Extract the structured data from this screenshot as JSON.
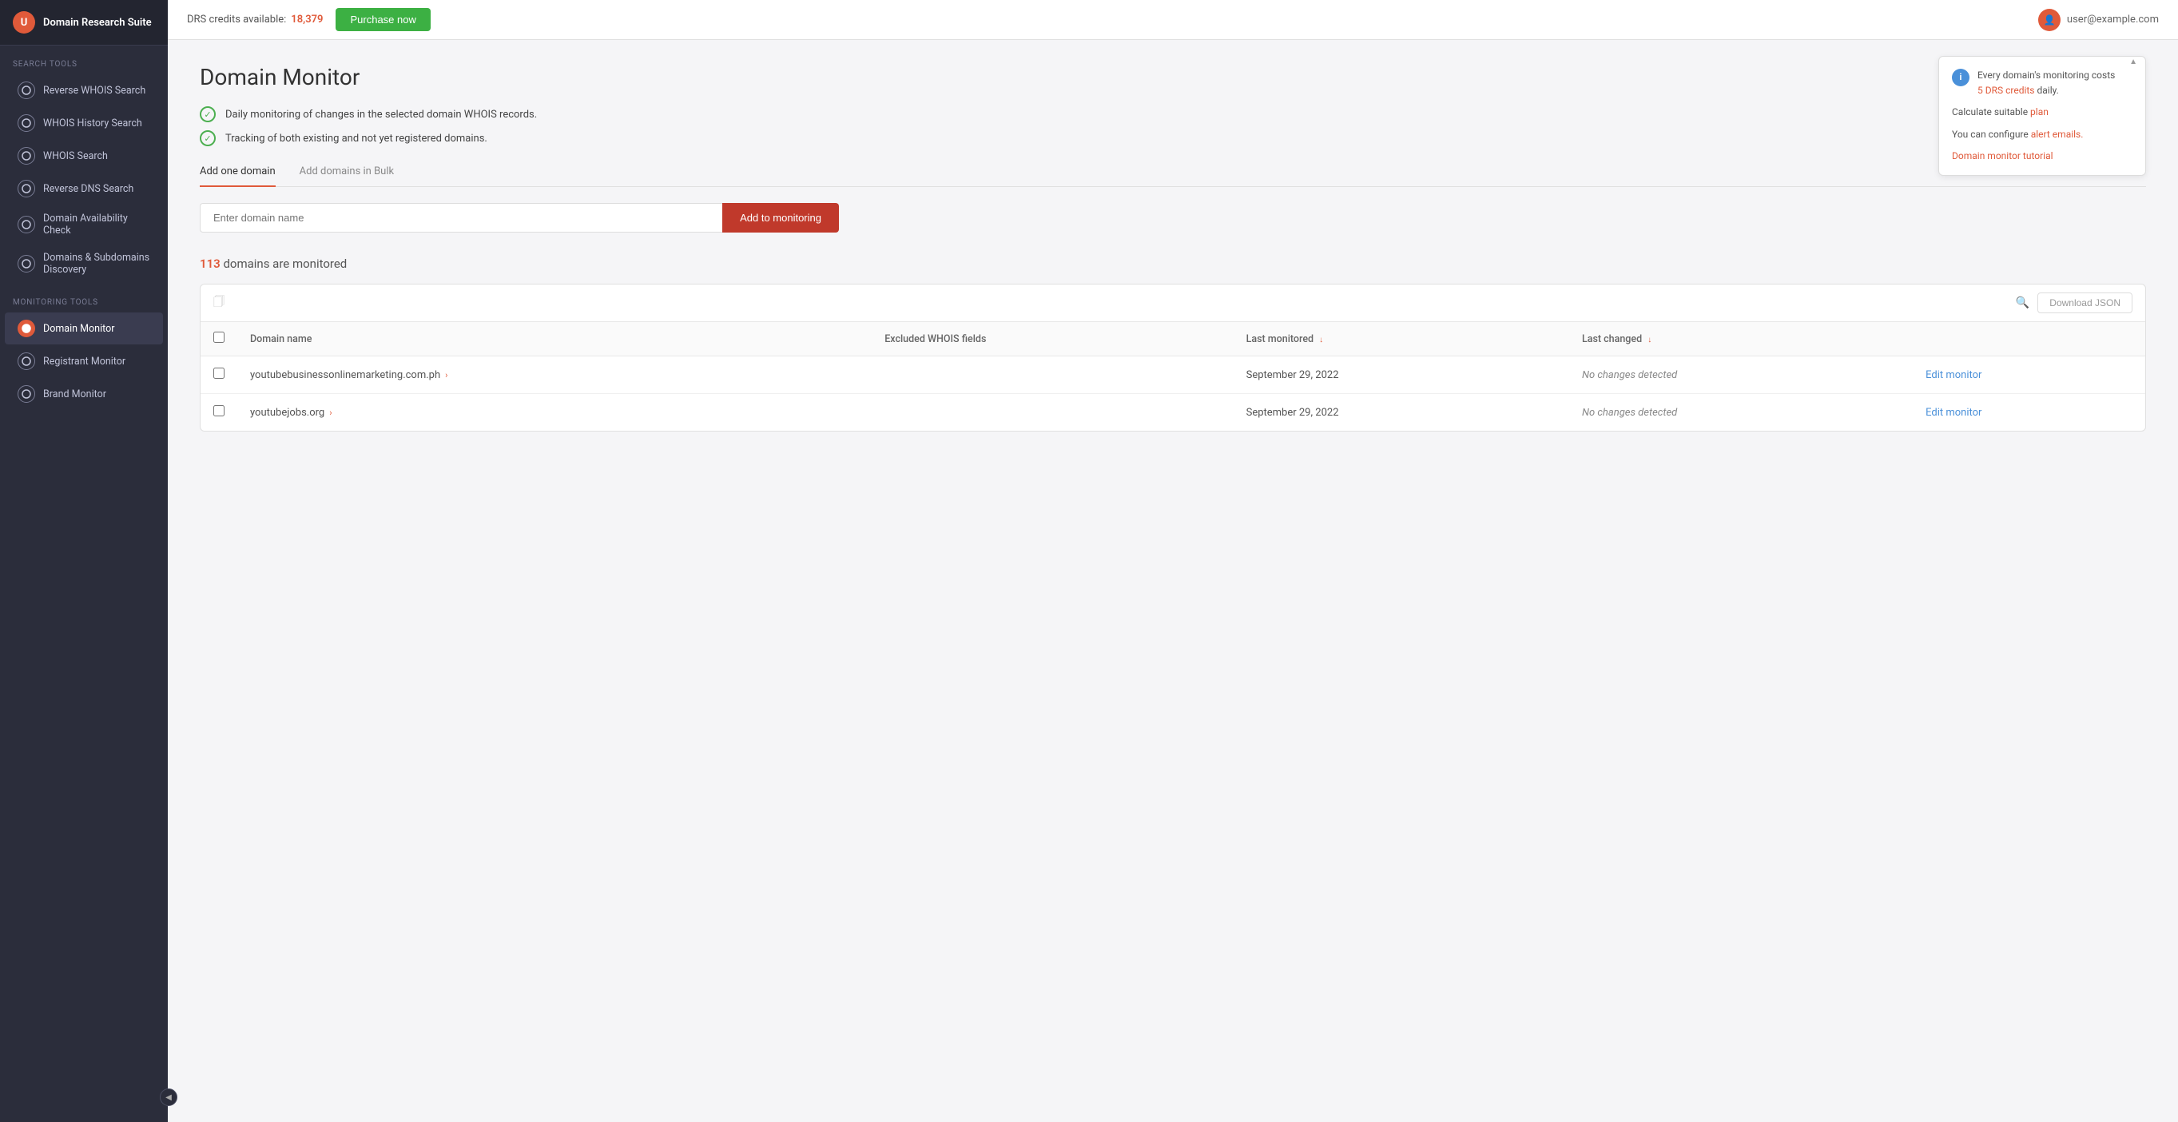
{
  "sidebar": {
    "logo_text": "U",
    "title": "Domain Research Suite",
    "search_tools_label": "Search tools",
    "search_items": [
      {
        "id": "reverse-whois",
        "label": "Reverse WHOIS Search",
        "icon": "⊙"
      },
      {
        "id": "whois-history",
        "label": "WHOIS History Search",
        "icon": "⊙"
      },
      {
        "id": "whois-search",
        "label": "WHOIS Search",
        "icon": "👤"
      },
      {
        "id": "reverse-dns",
        "label": "Reverse DNS Search",
        "icon": "⊕"
      },
      {
        "id": "domain-availability",
        "label": "Domain Availability Check",
        "icon": "⊙"
      },
      {
        "id": "domains-discovery",
        "label": "Domains & Subdomains Discovery",
        "icon": "⊕"
      }
    ],
    "monitoring_tools_label": "Monitoring tools",
    "monitoring_items": [
      {
        "id": "domain-monitor",
        "label": "Domain Monitor",
        "icon": "◉",
        "active": true
      },
      {
        "id": "registrant-monitor",
        "label": "Registrant Monitor",
        "icon": "⊙"
      },
      {
        "id": "brand-monitor",
        "label": "Brand Monitor",
        "icon": "®"
      }
    ]
  },
  "topbar": {
    "credits_label": "DRS credits available:",
    "credits_value": "18,379",
    "purchase_btn": "Purchase now",
    "user_name": "user@example.com"
  },
  "info_popup": {
    "body_text": "Every domain's monitoring costs",
    "credits_link": "5 DRS credits",
    "daily_text": "daily.",
    "plan_text": "Calculate suitable",
    "plan_link": "plan",
    "alert_text": "You can configure",
    "alert_link": "alert emails.",
    "tutorial_link": "Domain monitor tutorial"
  },
  "page": {
    "title": "Domain Monitor",
    "features": [
      "Daily monitoring of changes in the selected domain WHOIS records.",
      "Tracking of both existing and not yet registered domains."
    ],
    "tabs": [
      {
        "id": "add-one",
        "label": "Add one domain",
        "active": true
      },
      {
        "id": "add-bulk",
        "label": "Add domains in Bulk",
        "active": false
      }
    ],
    "input_placeholder": "Enter domain name",
    "add_btn": "Add to monitoring",
    "monitored_count": "113",
    "monitored_text": "domains are monitored",
    "download_btn": "Download JSON",
    "table": {
      "columns": [
        {
          "id": "domain-name",
          "label": "Domain name",
          "sortable": false
        },
        {
          "id": "excluded-whois",
          "label": "Excluded WHOIS fields",
          "sortable": false
        },
        {
          "id": "last-monitored",
          "label": "Last monitored",
          "sortable": true
        },
        {
          "id": "last-changed",
          "label": "Last changed",
          "sortable": true
        }
      ],
      "rows": [
        {
          "id": "row-1",
          "domain": "youtubebusinessonlinemarketing.com.ph",
          "excluded_whois": "",
          "last_monitored": "September 29, 2022",
          "last_changed": "No changes detected",
          "edit_label": "Edit monitor"
        },
        {
          "id": "row-2",
          "domain": "youtubejobs.org",
          "excluded_whois": "",
          "last_monitored": "September 29, 2022",
          "last_changed": "No changes detected",
          "edit_label": "Edit monitor"
        }
      ]
    }
  }
}
